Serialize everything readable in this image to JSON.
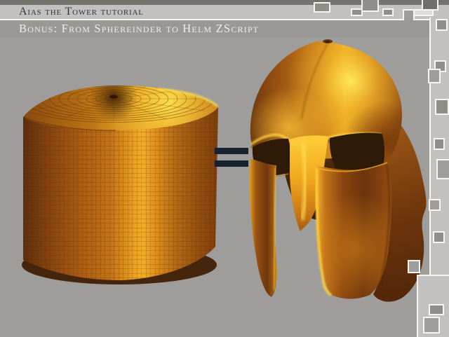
{
  "header": {
    "title": "Aias the Tower tutorial",
    "subtitle": "Bonus: From Sphereinder to Helm ZScript"
  },
  "content": {
    "equals_symbol": "="
  },
  "colors": {
    "canvas": "#9e9d9b",
    "band_light": "#c2c1bf",
    "band_subtitle": "#999894",
    "frame_outline": "#f6f5f3",
    "title_text": "#2b3441",
    "subtitle_text": "#efede9",
    "equals": "#18222e",
    "gold_highlight": "#ffe44e",
    "gold_mid": "#d0801a",
    "gold_dark": "#6e360c"
  }
}
